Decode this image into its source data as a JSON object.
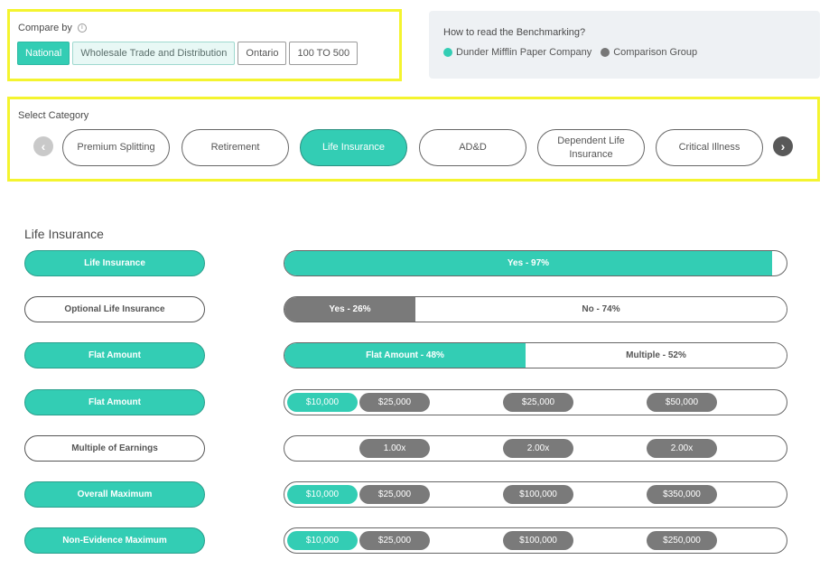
{
  "compare": {
    "title": "Compare by",
    "chips": [
      "National",
      "Wholesale Trade and Distribution",
      "Ontario",
      "100 TO 500"
    ]
  },
  "howto": {
    "title": "How to read the Benchmarking?",
    "company": "Dunder Mifflin Paper Company",
    "comparison": "Comparison Group"
  },
  "category": {
    "title": "Select Category",
    "items": [
      "Premium Splitting",
      "Retirement",
      "Life Insurance",
      "AD&D",
      "Dependent Life Insurance",
      "Critical Illness"
    ],
    "active": "Life Insurance"
  },
  "section": {
    "title": "Life Insurance",
    "rows": [
      {
        "label": "Life Insurance",
        "segments": [
          {
            "text": "Yes - 97%"
          }
        ]
      },
      {
        "label": "Optional Life Insurance",
        "segments": [
          {
            "text": "Yes - 26%"
          },
          {
            "text": "No - 74%"
          }
        ]
      },
      {
        "label": "Flat Amount",
        "segments": [
          {
            "text": "Flat Amount - 48%"
          },
          {
            "text": "Multiple - 52%"
          }
        ]
      },
      {
        "label": "Flat Amount",
        "pills": [
          "$10,000",
          "$25,000",
          "$25,000",
          "$50,000"
        ]
      },
      {
        "label": "Multiple of Earnings",
        "pills": [
          "1.00x",
          "2.00x",
          "2.00x"
        ]
      },
      {
        "label": "Overall Maximum",
        "pills": [
          "$10,000",
          "$25,000",
          "$100,000",
          "$350,000"
        ]
      },
      {
        "label": "Non-Evidence Maximum",
        "pills": [
          "$10,000",
          "$25,000",
          "$100,000",
          "$250,000"
        ]
      }
    ]
  },
  "colors": {
    "accent": "#33cdb4",
    "comparison": "#7a7a7a",
    "highlight": "#f4f42f"
  }
}
